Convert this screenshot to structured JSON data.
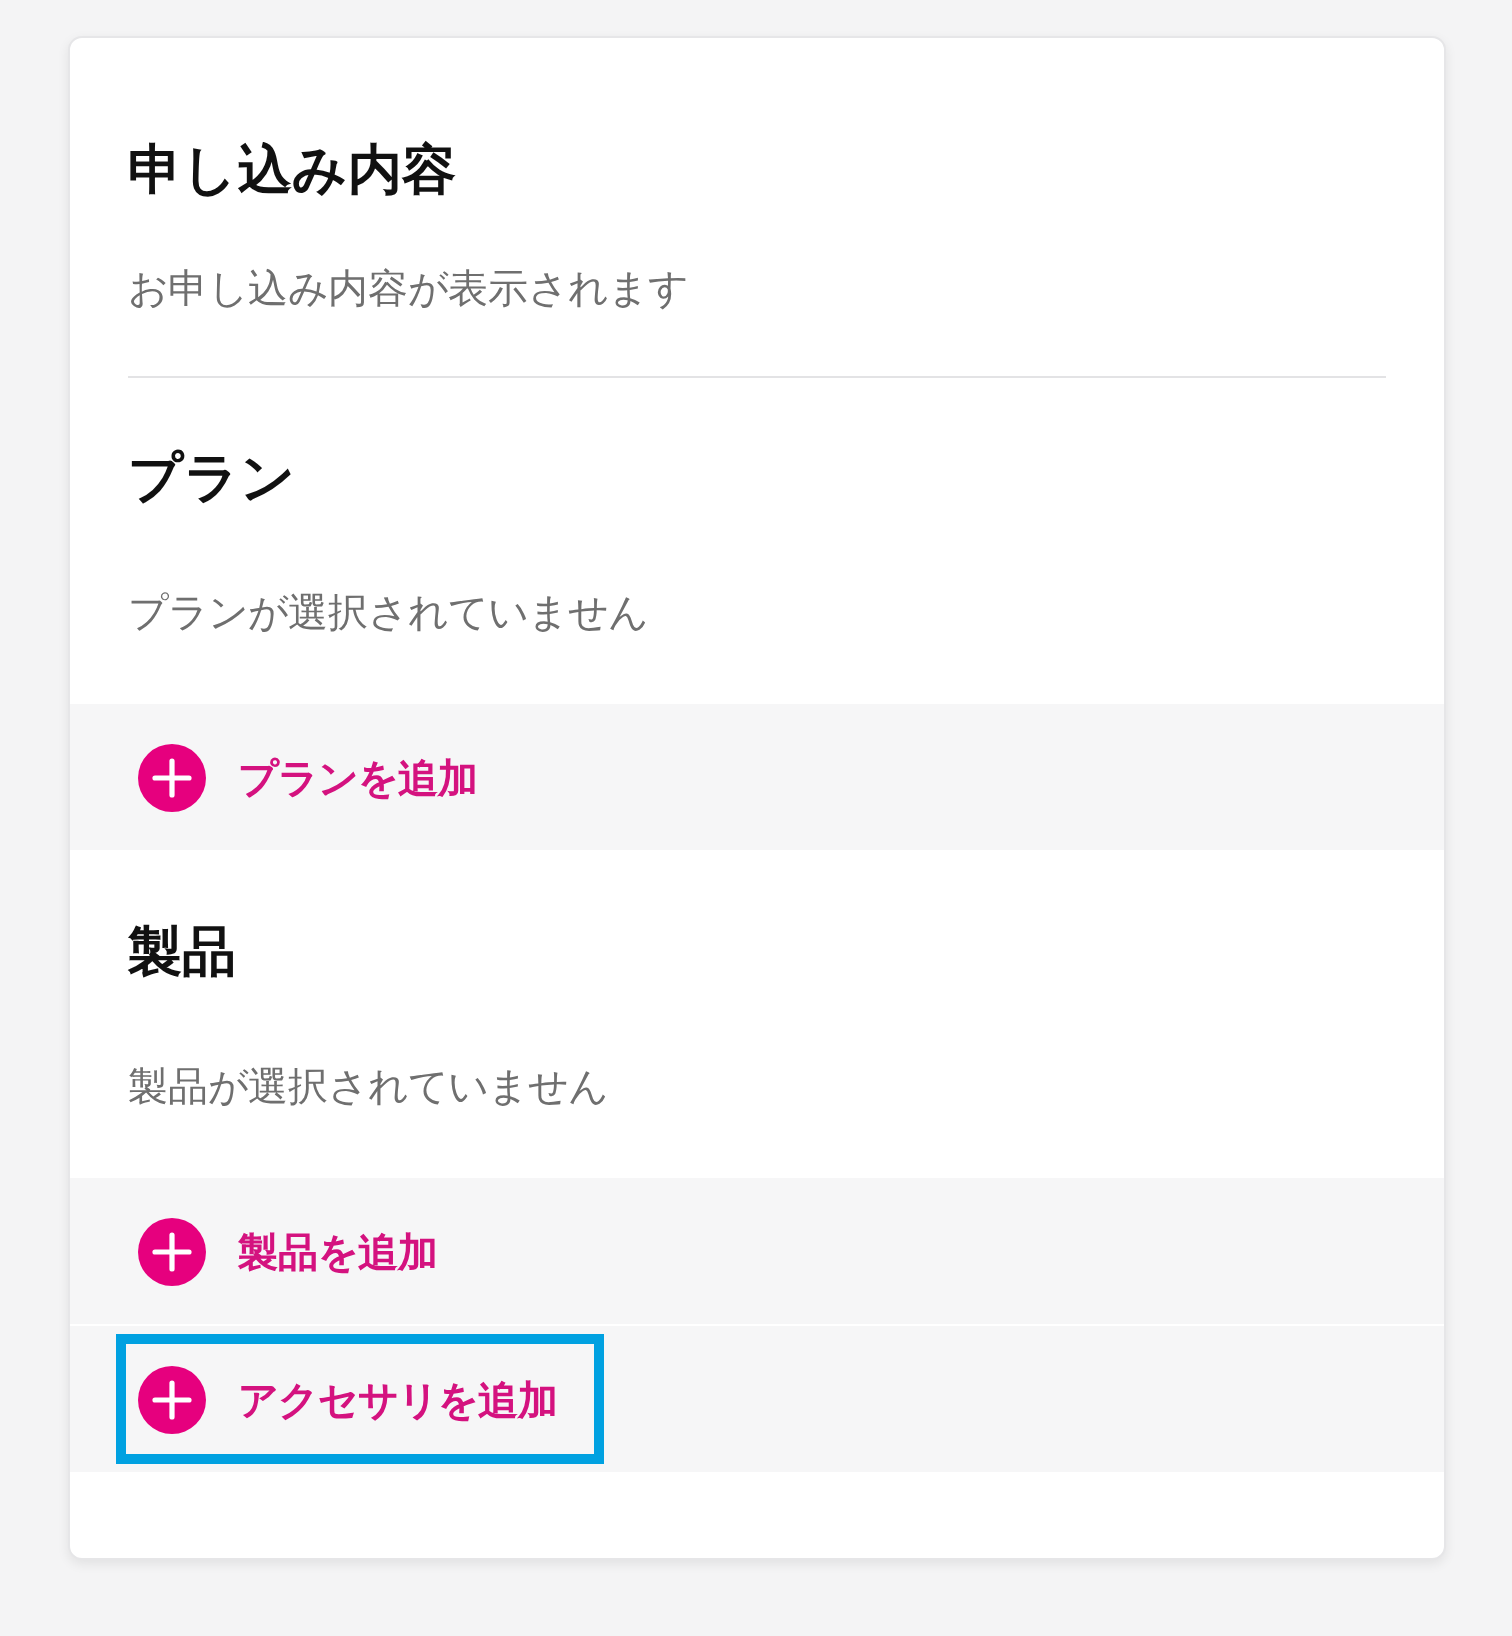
{
  "summary": {
    "title": "申し込み内容",
    "description": "お申し込み内容が表示されます"
  },
  "sections": [
    {
      "title": "プラン",
      "description": "プランが選択されていません",
      "actions": [
        {
          "label": "プランを追加",
          "highlighted": false
        }
      ]
    },
    {
      "title": "製品",
      "description": "製品が選択されていません",
      "actions": [
        {
          "label": "製品を追加",
          "highlighted": false
        },
        {
          "label": "アクセサリを追加",
          "highlighted": true
        }
      ]
    }
  ]
}
